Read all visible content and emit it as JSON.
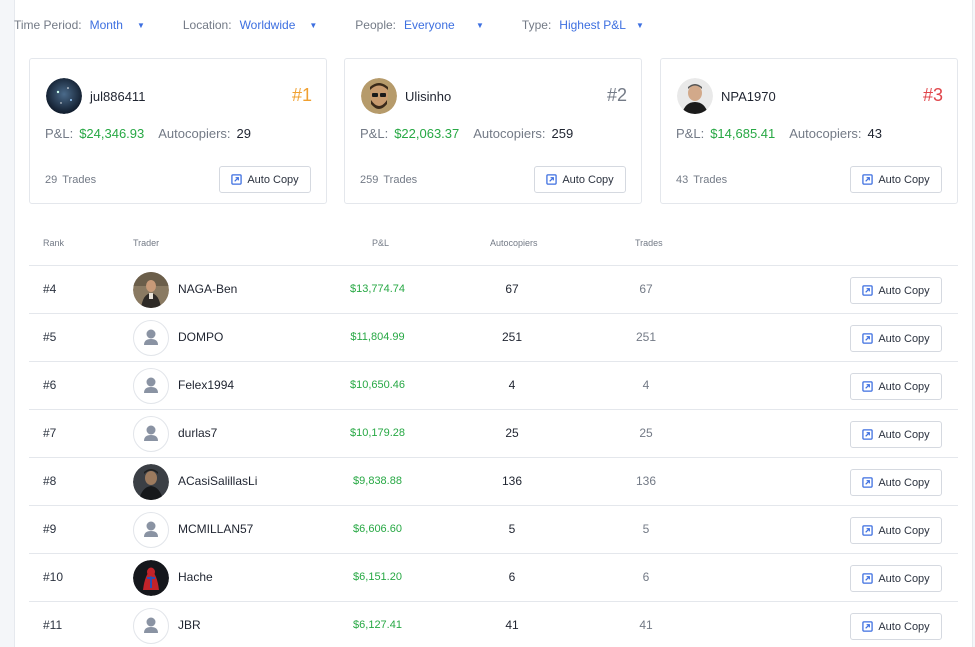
{
  "filters": [
    {
      "label": "Time Period:",
      "value": "Month"
    },
    {
      "label": "Location:",
      "value": "Worldwide"
    },
    {
      "label": "People:",
      "value": "Everyone"
    },
    {
      "label": "Type:",
      "value": "Highest P&L"
    }
  ],
  "top_cards": [
    {
      "name": "jul886411",
      "rank": "#1",
      "rank_color": "#f0a030",
      "pl_label": "P&L:",
      "pl": "$24,346.93",
      "ac_label": "Autocopiers:",
      "autocopiers": "29",
      "trades_count": "29",
      "trades_label": "Trades",
      "button": "Auto Copy"
    },
    {
      "name": "Ulisinho",
      "rank": "#2",
      "rank_color": "#737a86",
      "pl_label": "P&L:",
      "pl": "$22,063.37",
      "ac_label": "Autocopiers:",
      "autocopiers": "259",
      "trades_count": "259",
      "trades_label": "Trades",
      "button": "Auto Copy"
    },
    {
      "name": "NPA1970",
      "rank": "#3",
      "rank_color": "#e0454a",
      "pl_label": "P&L:",
      "pl": "$14,685.41",
      "ac_label": "Autocopiers:",
      "autocopiers": "43",
      "trades_count": "43",
      "trades_label": "Trades",
      "button": "Auto Copy"
    }
  ],
  "table": {
    "headers": {
      "rank": "Rank",
      "trader": "Trader",
      "pl": "P&L",
      "autocopiers": "Autocopiers",
      "trades": "Trades"
    },
    "rows": [
      {
        "rank": "#4",
        "name": "NAGA-Ben",
        "pl": "$13,774.74",
        "autocopiers": "67",
        "trades": "67",
        "button": "Auto Copy",
        "avatar": "photo"
      },
      {
        "rank": "#5",
        "name": "DOMPO",
        "pl": "$11,804.99",
        "autocopiers": "251",
        "trades": "251",
        "button": "Auto Copy",
        "avatar": "default"
      },
      {
        "rank": "#6",
        "name": "Felex1994",
        "pl": "$10,650.46",
        "autocopiers": "4",
        "trades": "4",
        "button": "Auto Copy",
        "avatar": "default"
      },
      {
        "rank": "#7",
        "name": "durlas7",
        "pl": "$10,179.28",
        "autocopiers": "25",
        "trades": "25",
        "button": "Auto Copy",
        "avatar": "default"
      },
      {
        "rank": "#8",
        "name": "ACasiSalillasLi",
        "pl": "$9,838.88",
        "autocopiers": "136",
        "trades": "136",
        "button": "Auto Copy",
        "avatar": "photo"
      },
      {
        "rank": "#9",
        "name": "MCMILLAN57",
        "pl": "$6,606.60",
        "autocopiers": "5",
        "trades": "5",
        "button": "Auto Copy",
        "avatar": "default"
      },
      {
        "rank": "#10",
        "name": "Hache",
        "pl": "$6,151.20",
        "autocopiers": "6",
        "trades": "6",
        "button": "Auto Copy",
        "avatar": "photo"
      },
      {
        "rank": "#11",
        "name": "JBR",
        "pl": "$6,127.41",
        "autocopiers": "41",
        "trades": "41",
        "button": "Auto Copy",
        "avatar": "default"
      }
    ]
  },
  "colors": {
    "accent": "#3d6fe0",
    "positive": "#27a844"
  }
}
